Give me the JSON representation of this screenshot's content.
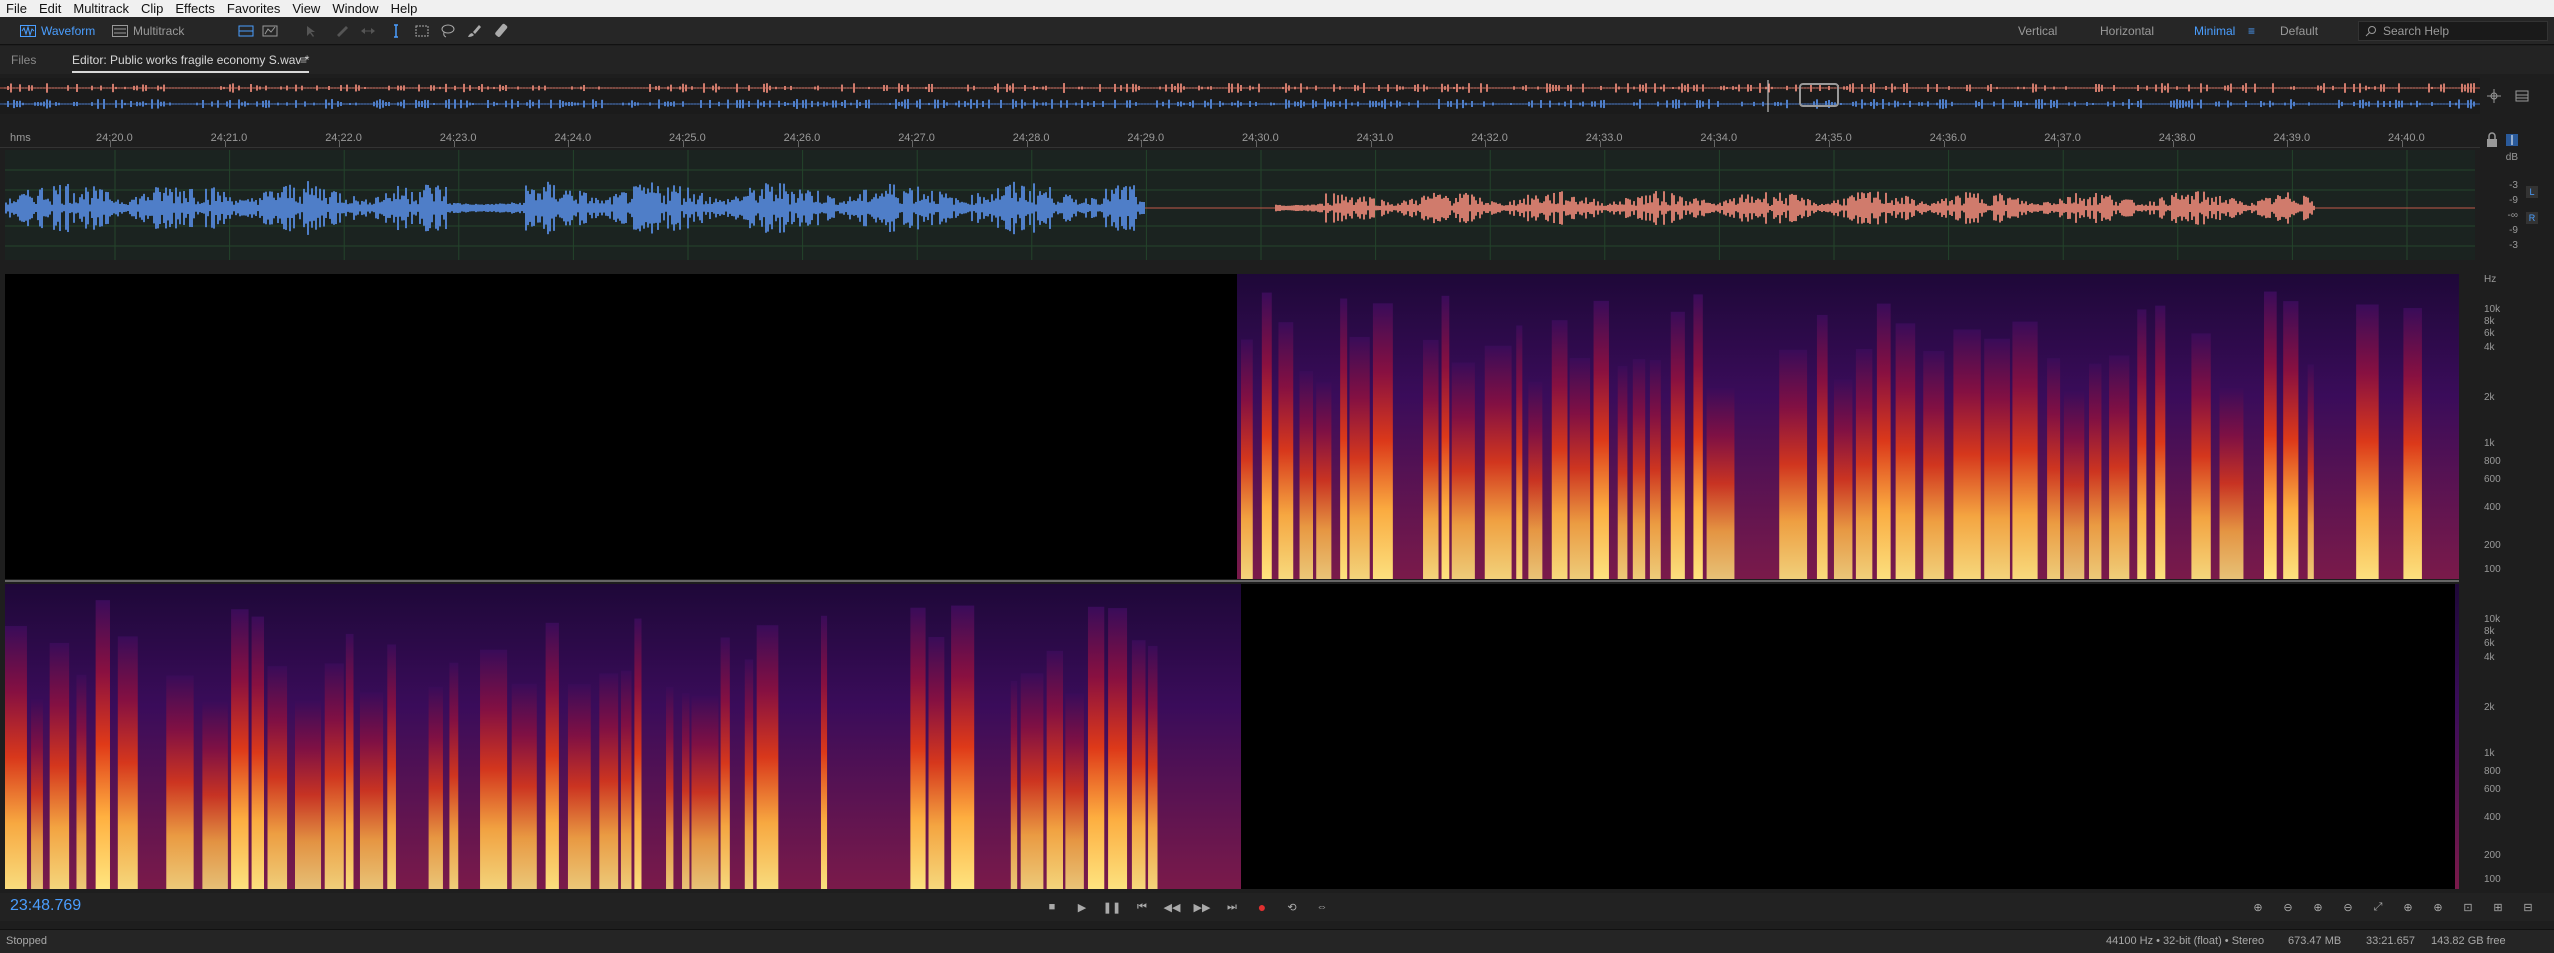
{
  "menu": [
    "File",
    "Edit",
    "Multitrack",
    "Clip",
    "Effects",
    "Favorites",
    "View",
    "Window",
    "Help"
  ],
  "toolbar": {
    "waveform_label": "Waveform",
    "multitrack_label": "Multitrack",
    "workspaces": [
      "Vertical",
      "Horizontal",
      "Minimal",
      "Default"
    ],
    "active_workspace": "Minimal",
    "search_placeholder": "Search Help"
  },
  "panels": {
    "files_tab": "Files",
    "editor_tab": "Editor: Public works fragile economy S.wav *"
  },
  "ruler": {
    "unit": "hms",
    "ticks": [
      "24:20.0",
      "24:21.0",
      "24:22.0",
      "24:23.0",
      "24:24.0",
      "24:25.0",
      "24:26.0",
      "24:27.0",
      "24:28.0",
      "24:29.0",
      "24:30.0",
      "24:31.0",
      "24:32.0",
      "24:33.0",
      "24:34.0",
      "24:35.0",
      "24:36.0",
      "24:37.0",
      "24:38.0",
      "24:39.0",
      "24:40.0"
    ]
  },
  "db_scale": [
    "dB",
    "-3",
    "-9",
    "-∞",
    "-9",
    "-3"
  ],
  "channels": [
    "L",
    "R"
  ],
  "hz_scale": [
    "Hz",
    "10k",
    "8k",
    "6k",
    "4k",
    "2k",
    "1k",
    "800",
    "600",
    "400",
    "200",
    "100"
  ],
  "transport": {
    "timecode": "23:48.769"
  },
  "status": {
    "state": "Stopped",
    "format": "44100 Hz • 32-bit (float) • Stereo",
    "size": "673.47 MB",
    "duration": "33:21.657",
    "free": "143.82 GB free"
  },
  "colors": {
    "accent": "#4a9eff",
    "left_wave": "#4f7ec8",
    "right_wave": "#d07b6c",
    "spectrogram_hot": "#ffe680",
    "spectrogram_mid": "#e03a18",
    "spectrogram_cold": "#2a0c4a"
  }
}
